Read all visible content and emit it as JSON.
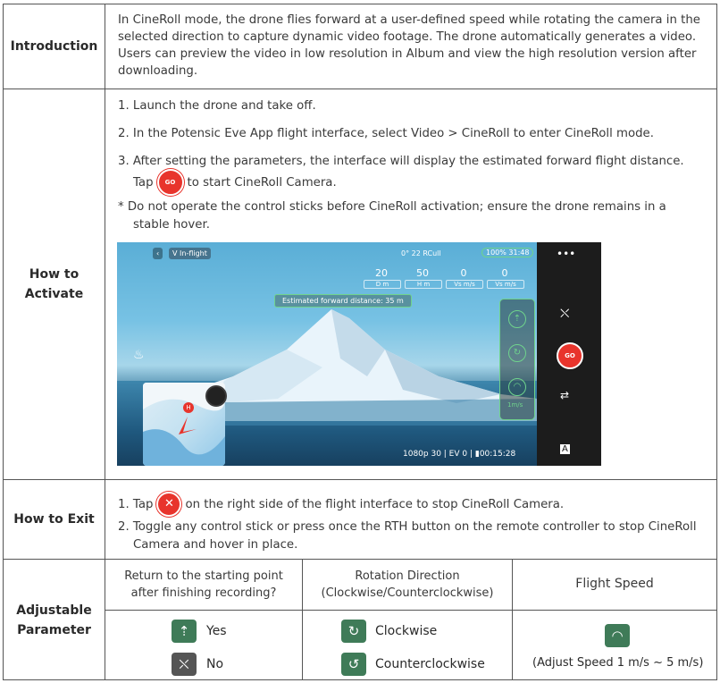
{
  "rows": {
    "introduction": {
      "heading": "Introduction",
      "lines": [
        "In CineRoll mode, the drone flies forward at a user-defined speed while rotating the camera in the",
        "selected direction to capture dynamic video footage. The drone automatically generates a video.",
        "Users can preview the video in low resolution in Album and view the high resolution version after",
        "downloading."
      ]
    },
    "how_to_activate": {
      "heading": "How to Activate",
      "step1": "1. Launch the drone and take off.",
      "step2": "2. In the Potensic Eve App flight interface, select Video > CineRoll to enter CineRoll mode.",
      "step3_line1": "3. After setting the parameters, the interface will display the estimated forward flight distance.",
      "step3_tap": "Tap",
      "step3_after": "to start CineRoll Camera.",
      "note_line1": "* Do not operate the control sticks before CineRoll activation; ensure the drone remains in a",
      "note_line2": "stable hover.",
      "go_label": "GO"
    },
    "screenshot": {
      "mode_chip": "V  In-flight",
      "status_top": "0°   22  RCull",
      "battery": "100% 31:48",
      "menu": "•••",
      "telemetry": [
        {
          "value": "20",
          "unit": "D m"
        },
        {
          "value": "50",
          "unit": "H m"
        },
        {
          "value": "0",
          "unit": "Vs m/s"
        },
        {
          "value": "0",
          "unit": "Vs m/s"
        }
      ],
      "forward_distance": "Estimated forward distance: 35 m",
      "speed_unit": "1m/s",
      "go_label": "GO",
      "bottom_status": "1080p 30 | EV 0 | ▮00:15:28",
      "map_marker": "H"
    },
    "how_to_exit": {
      "heading": "How to Exit",
      "step1_tap": "1. Tap",
      "step1_after": "on the right side of the flight interface to stop CineRoll Camera.",
      "step2_line1": "2. Toggle any control stick or press once the RTH button on the remote controller to stop CineRoll",
      "step2_line2": "Camera and hover in place.",
      "x_label": "✕"
    },
    "adjustable_parameter": {
      "heading": "Adjustable Parameter",
      "columns": [
        {
          "header_line1": "Return to the starting point",
          "header_line2": "after finishing recording?"
        },
        {
          "header_line1": "Rotation Direction",
          "header_line2": "(Clockwise/Counterclockwise)"
        },
        {
          "header_line1": "Flight Speed",
          "header_line2": ""
        }
      ],
      "return_options": [
        "Yes",
        "No"
      ],
      "rotation_options": [
        "Clockwise",
        "Counterclockwise"
      ],
      "speed_note": "(Adjust Speed 1 m/s ~ 5 m/s)"
    }
  },
  "colors": {
    "border": "#555555",
    "go_red": "#e8342c",
    "icon_green": "#3f7b58",
    "hud_green": "#6fd38c"
  }
}
